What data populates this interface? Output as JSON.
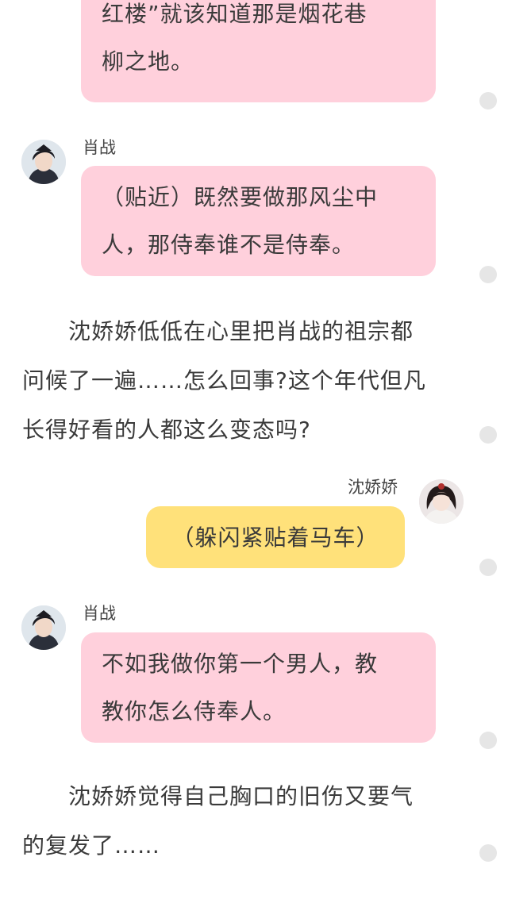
{
  "messages": [
    {
      "speaker": "",
      "text": "红楼”就该知道那是烟花巷柳之地。",
      "lines": [
        "红楼”就该知道那是烟花巷",
        "柳之地。"
      ]
    },
    {
      "speaker": "肖战",
      "avatar_icon": "male-character-avatar",
      "lines": [
        "（贴近）既然要做那风尘中",
        "人，那侍奉谁不是侍奉。"
      ]
    },
    {
      "narration_lines": [
        "　　沈娇娇低低在心里把肖战的祖宗都",
        "问候了一遍……怎么回事?这个年代但凡",
        "长得好看的人都这么变态吗?"
      ]
    },
    {
      "speaker": "沈娇娇",
      "avatar_icon": "female-character-avatar",
      "lines": [
        "（躲闪紧贴着马车）"
      ]
    },
    {
      "speaker": "肖战",
      "avatar_icon": "male-character-avatar",
      "lines": [
        "不如我做你第一个男人，教",
        "教你怎么侍奉人。"
      ]
    },
    {
      "narration_lines": [
        "　　沈娇娇觉得自己胸口的旧伤又要气",
        "的复发了……"
      ]
    }
  ],
  "colors": {
    "pink_bubble": "#ffd0dc",
    "yellow_bubble": "#ffe17a",
    "side_dot": "#e6e6e6"
  }
}
